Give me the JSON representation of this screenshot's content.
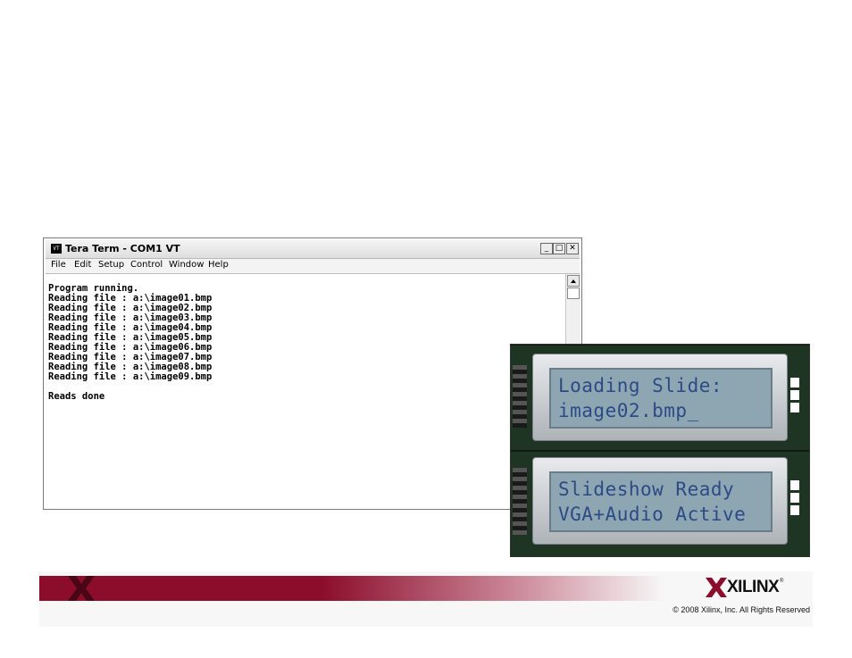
{
  "window": {
    "title": "Tera Term - COM1 VT",
    "icon": "terminal-icon",
    "controls": {
      "minimize": "_",
      "maximize": "□",
      "close": "✕"
    }
  },
  "menu": [
    "File",
    "Edit",
    "Setup",
    "Control",
    "Window",
    "Help"
  ],
  "terminal_lines": [
    "Program running.",
    "Reading file : a:\\image01.bmp",
    "Reading file : a:\\image02.bmp",
    "Reading file : a:\\image03.bmp",
    "Reading file : a:\\image04.bmp",
    "Reading file : a:\\image05.bmp",
    "Reading file : a:\\image06.bmp",
    "Reading file : a:\\image07.bmp",
    "Reading file : a:\\image08.bmp",
    "Reading file : a:\\image09.bmp",
    "",
    "Reads done"
  ],
  "lcd": [
    {
      "line1": "Loading Slide:",
      "line2": "image02.bmp_"
    },
    {
      "line1": "Slideshow Ready",
      "line2": "VGA+Audio Active"
    }
  ],
  "footer": {
    "logo_text": "XILINX",
    "logo_mark": "®",
    "copyright": "© 2008 Xilinx, Inc. All Rights Reserved",
    "colors": {
      "band": "#8b0d2b",
      "lcd_text": "#2c4a86"
    }
  }
}
